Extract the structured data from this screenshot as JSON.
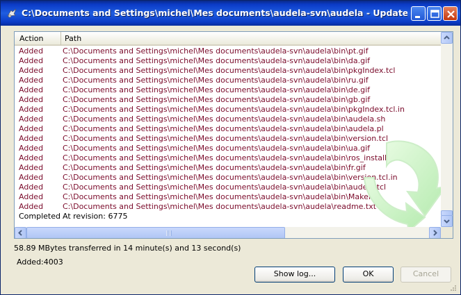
{
  "window": {
    "title": "C:\\Documents and Settings\\michel\\Mes documents\\audela-svn\\audela - Update - Tortois...",
    "controls": {
      "minimize_icon": "minimize-icon",
      "maximize_icon": "maximize-icon",
      "close_icon": "close-icon"
    }
  },
  "list": {
    "columns": {
      "action": "Action",
      "path": "Path"
    },
    "rows": [
      {
        "action": "Added",
        "path": "C:\\Documents and Settings\\michel\\Mes documents\\audela-svn\\audela\\bin\\pt.gif"
      },
      {
        "action": "Added",
        "path": "C:\\Documents and Settings\\michel\\Mes documents\\audela-svn\\audela\\bin\\da.gif"
      },
      {
        "action": "Added",
        "path": "C:\\Documents and Settings\\michel\\Mes documents\\audela-svn\\audela\\bin\\pkgIndex.tcl"
      },
      {
        "action": "Added",
        "path": "C:\\Documents and Settings\\michel\\Mes documents\\audela-svn\\audela\\bin\\ru.gif"
      },
      {
        "action": "Added",
        "path": "C:\\Documents and Settings\\michel\\Mes documents\\audela-svn\\audela\\bin\\de.gif"
      },
      {
        "action": "Added",
        "path": "C:\\Documents and Settings\\michel\\Mes documents\\audela-svn\\audela\\bin\\gb.gif"
      },
      {
        "action": "Added",
        "path": "C:\\Documents and Settings\\michel\\Mes documents\\audela-svn\\audela\\bin\\pkgIndex.tcl.in"
      },
      {
        "action": "Added",
        "path": "C:\\Documents and Settings\\michel\\Mes documents\\audela-svn\\audela\\bin\\audela.sh"
      },
      {
        "action": "Added",
        "path": "C:\\Documents and Settings\\michel\\Mes documents\\audela-svn\\audela\\bin\\audela.pl"
      },
      {
        "action": "Added",
        "path": "C:\\Documents and Settings\\michel\\Mes documents\\audela-svn\\audela\\bin\\version.tcl"
      },
      {
        "action": "Added",
        "path": "C:\\Documents and Settings\\michel\\Mes documents\\audela-svn\\audela\\bin\\ua.gif"
      },
      {
        "action": "Added",
        "path": "C:\\Documents and Settings\\michel\\Mes documents\\audela-svn\\audela\\bin\\ros_install.tcl"
      },
      {
        "action": "Added",
        "path": "C:\\Documents and Settings\\michel\\Mes documents\\audela-svn\\audela\\bin\\fr.gif"
      },
      {
        "action": "Added",
        "path": "C:\\Documents and Settings\\michel\\Mes documents\\audela-svn\\audela\\bin\\version.tcl.in"
      },
      {
        "action": "Added",
        "path": "C:\\Documents and Settings\\michel\\Mes documents\\audela-svn\\audela\\bin\\audela.tcl"
      },
      {
        "action": "Added",
        "path": "C:\\Documents and Settings\\michel\\Mes documents\\audela-svn\\audela\\bin\\Makefile"
      },
      {
        "action": "Added",
        "path": "C:\\Documents and Settings\\michel\\Mes documents\\audela-svn\\audela\\readme.txt"
      },
      {
        "action": "Completed",
        "path": "At revision: 6775"
      }
    ]
  },
  "status": {
    "transfer": "58.89 MBytes transferred in 14 minute(s) and 13 second(s)",
    "added": "Added:4003"
  },
  "buttons": {
    "show_log": "Show log...",
    "ok": "OK",
    "cancel": "Cancel"
  },
  "colors": {
    "title_bar": "#0b3bc7",
    "added_text": "#7a0a2a",
    "window_bg": "#ece9d8"
  }
}
